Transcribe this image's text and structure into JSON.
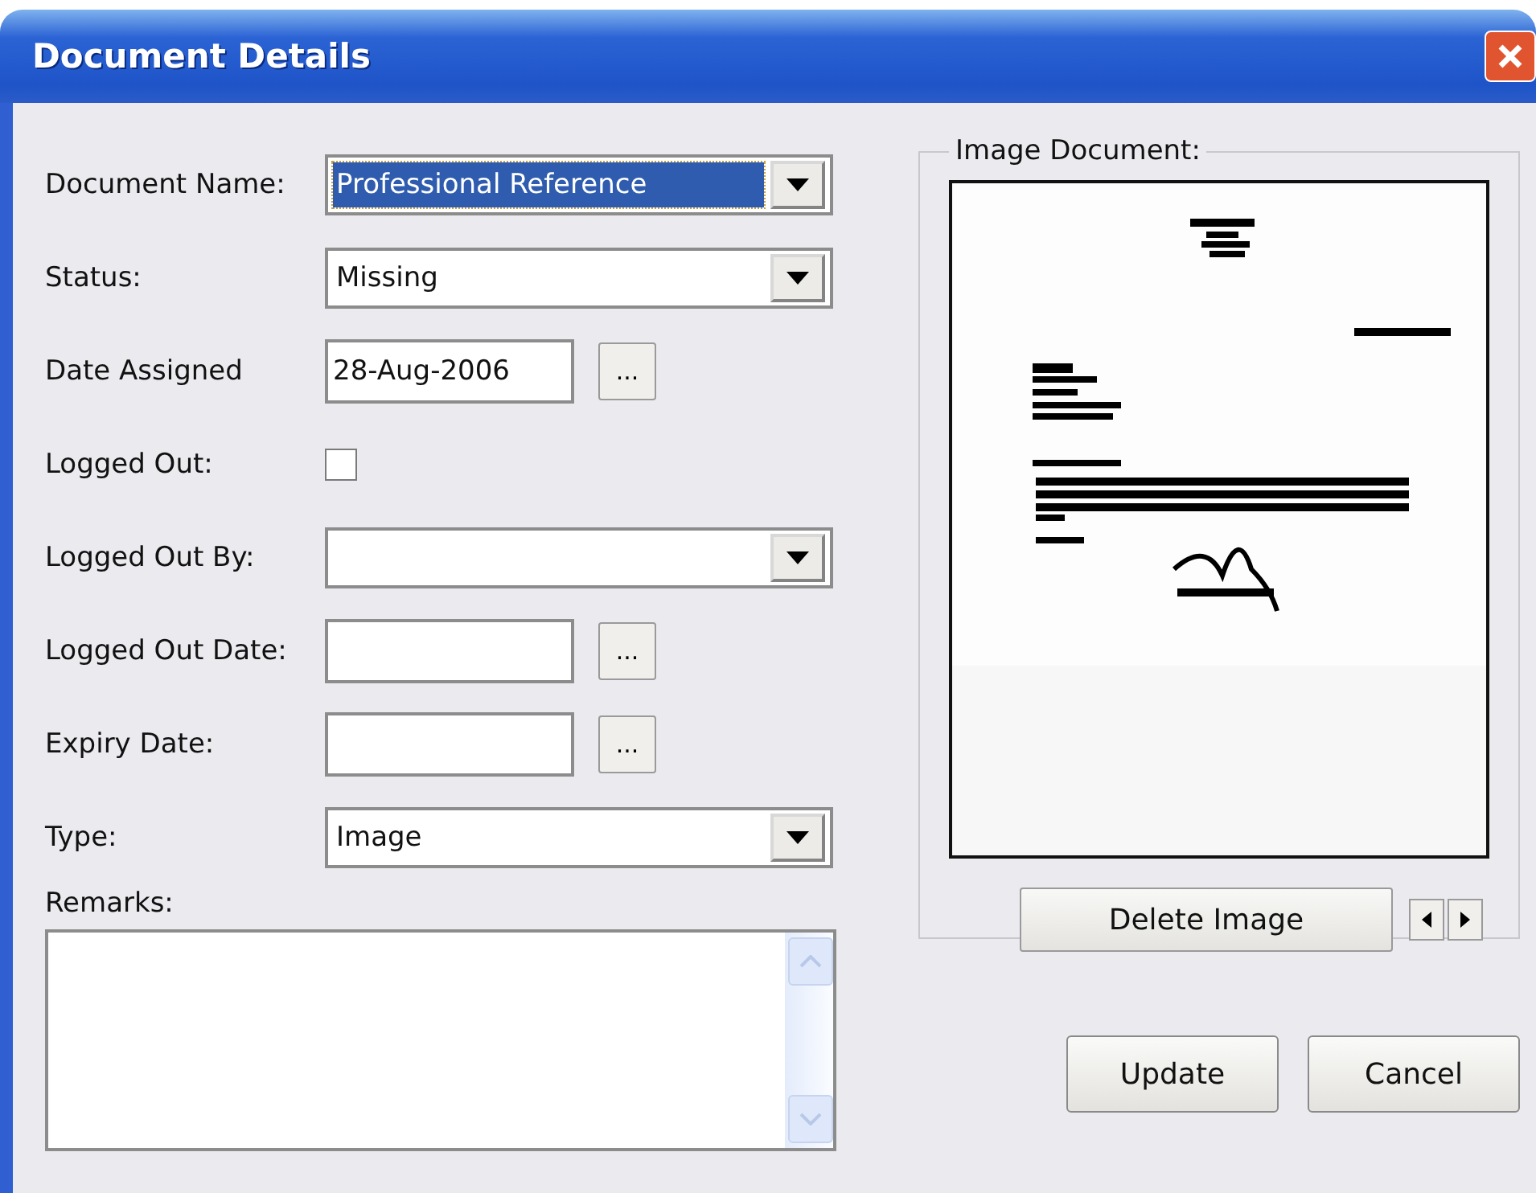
{
  "window": {
    "title": "Document Details"
  },
  "fields": [
    {
      "kind": "combo",
      "label": "Document Name:",
      "value": "Professional Reference",
      "selected": true
    },
    {
      "kind": "combo",
      "label": "Status:",
      "value": "Missing",
      "selected": false
    },
    {
      "kind": "date",
      "label": "Date Assigned",
      "value": "28-Aug-2006",
      "picker": "..."
    },
    {
      "kind": "checkbox",
      "label": "Logged Out:",
      "checked": false
    },
    {
      "kind": "combo",
      "label": "Logged Out By:",
      "selected": false
    },
    {
      "kind": "date",
      "label": "Logged Out Date:",
      "picker": "..."
    },
    {
      "kind": "date",
      "label": "Expiry Date:",
      "picker": "..."
    },
    {
      "kind": "combo",
      "label": "Type:",
      "value": "Image",
      "selected": false
    }
  ],
  "remarks": {
    "label": "Remarks:"
  },
  "image_panel": {
    "title": "Image Document:",
    "delete_button": "Delete Image"
  },
  "buttons": [
    "Update",
    "Cancel"
  ]
}
